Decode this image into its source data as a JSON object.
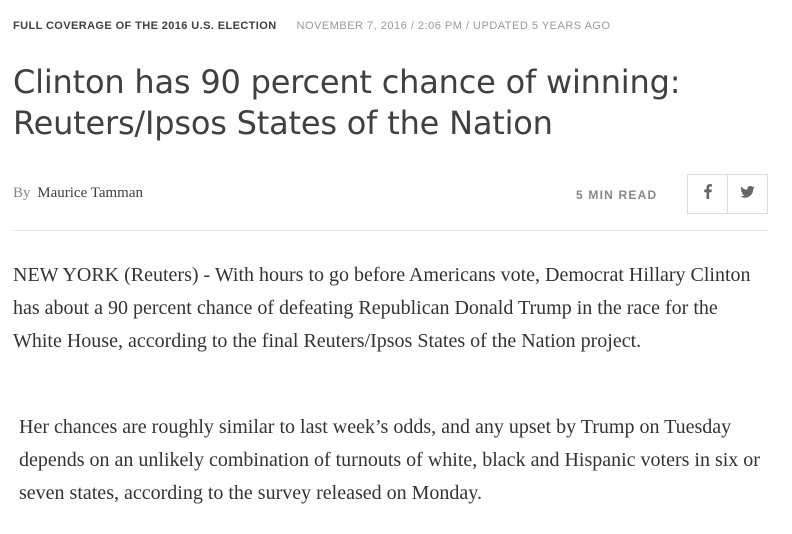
{
  "meta": {
    "section_link": "FULL COVERAGE OF THE 2016 U.S. ELECTION",
    "dateline": "NOVEMBER 7, 2016 / 2:06 PM / UPDATED 5 YEARS AGO"
  },
  "article": {
    "headline": "Clinton has 90 percent chance of winning: Reuters/Ipsos States of the Nation",
    "byline_prefix": "By",
    "author": "Maurice Tamman",
    "read_time": "5 MIN READ",
    "paragraphs": [
      "NEW YORK (Reuters) - With hours to go before Americans vote, Democrat Hillary Clinton has about a 90 percent chance of defeating Republican Donald Trump in the race for the White House, according to the final Reuters/Ipsos States of the Nation project.",
      "Her chances are roughly similar to last week’s odds, and any upset by Trump on Tuesday depends on an unlikely combination of turnouts of white, black and Hispanic voters in six or seven states, according to the survey released on Monday."
    ]
  },
  "share": {
    "buttons": [
      {
        "icon": "facebook-icon"
      },
      {
        "icon": "twitter-icon"
      }
    ]
  },
  "colors": {
    "text_dark": "#404040",
    "text_muted": "#999999",
    "border": "#dddddd"
  }
}
